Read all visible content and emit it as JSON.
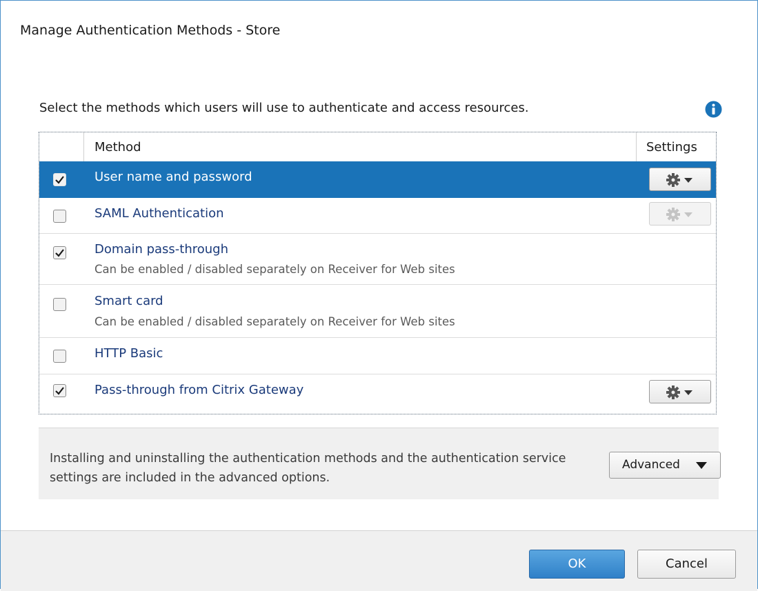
{
  "window": {
    "title": "Manage Authentication Methods - Store"
  },
  "intro": "Select the methods which users will use to authenticate and access resources.",
  "grid": {
    "columns": {
      "method": "Method",
      "settings": "Settings"
    },
    "rows": [
      {
        "name": "User name and password",
        "checked": true,
        "selected": true,
        "settings": "enabled"
      },
      {
        "name": "SAML Authentication",
        "checked": false,
        "selected": false,
        "settings": "disabled"
      },
      {
        "name": "Domain pass-through",
        "sub": "Can be enabled / disabled separately on Receiver for Web sites",
        "checked": true,
        "selected": false,
        "settings": "none"
      },
      {
        "name": "Smart card",
        "sub": "Can be enabled / disabled separately on Receiver for Web sites",
        "checked": false,
        "selected": false,
        "settings": "none"
      },
      {
        "name": "HTTP Basic",
        "checked": false,
        "selected": false,
        "settings": "none"
      },
      {
        "name": "Pass-through from Citrix Gateway",
        "checked": true,
        "selected": false,
        "settings": "enabled"
      }
    ]
  },
  "advanced_panel": {
    "text": "Installing and uninstalling the authentication methods and the authentication service settings are included in the advanced options.",
    "button_label": "Advanced"
  },
  "footer": {
    "ok_label": "OK",
    "cancel_label": "Cancel"
  },
  "colors": {
    "selection": "#1a73b8",
    "primary_button": "#2f80c8",
    "info_icon": "#1a73b8"
  },
  "icons": {
    "info": "info-icon",
    "gear": "gear-icon",
    "dropdown": "dropdown-arrow-icon",
    "check": "checkmark-icon"
  }
}
